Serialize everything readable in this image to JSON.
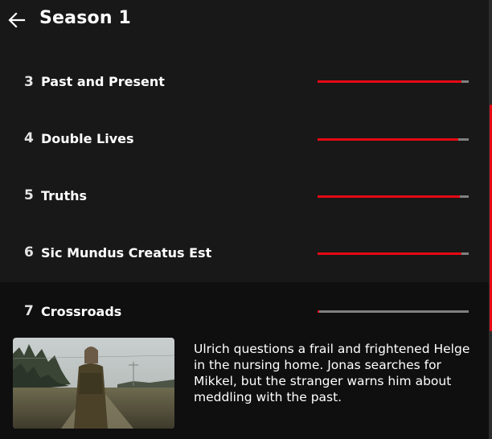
{
  "header": {
    "back_icon": "arrow-left-icon",
    "title": "Season 1"
  },
  "episodes": [
    {
      "number": "3",
      "title": "Past and Present",
      "progress": 0.95
    },
    {
      "number": "4",
      "title": "Double Lives",
      "progress": 0.93
    },
    {
      "number": "5",
      "title": "Truths",
      "progress": 0.94
    },
    {
      "number": "6",
      "title": "Sic Mundus Creatus Est",
      "progress": 0.95
    },
    {
      "number": "7",
      "title": "Crossroads",
      "progress": 0.01
    }
  ],
  "expanded_episode": {
    "synopsis": "Ulrich questions a frail and frightened Helge in the nursing home. Jonas searches for Mikkel, but the stranger warns him about meddling with the past."
  },
  "colors": {
    "background": "#181818",
    "expanded_background": "#0f0f0f",
    "progress_fill": "#e50914",
    "progress_track": "#808080",
    "scrollbar": "#e50914"
  }
}
